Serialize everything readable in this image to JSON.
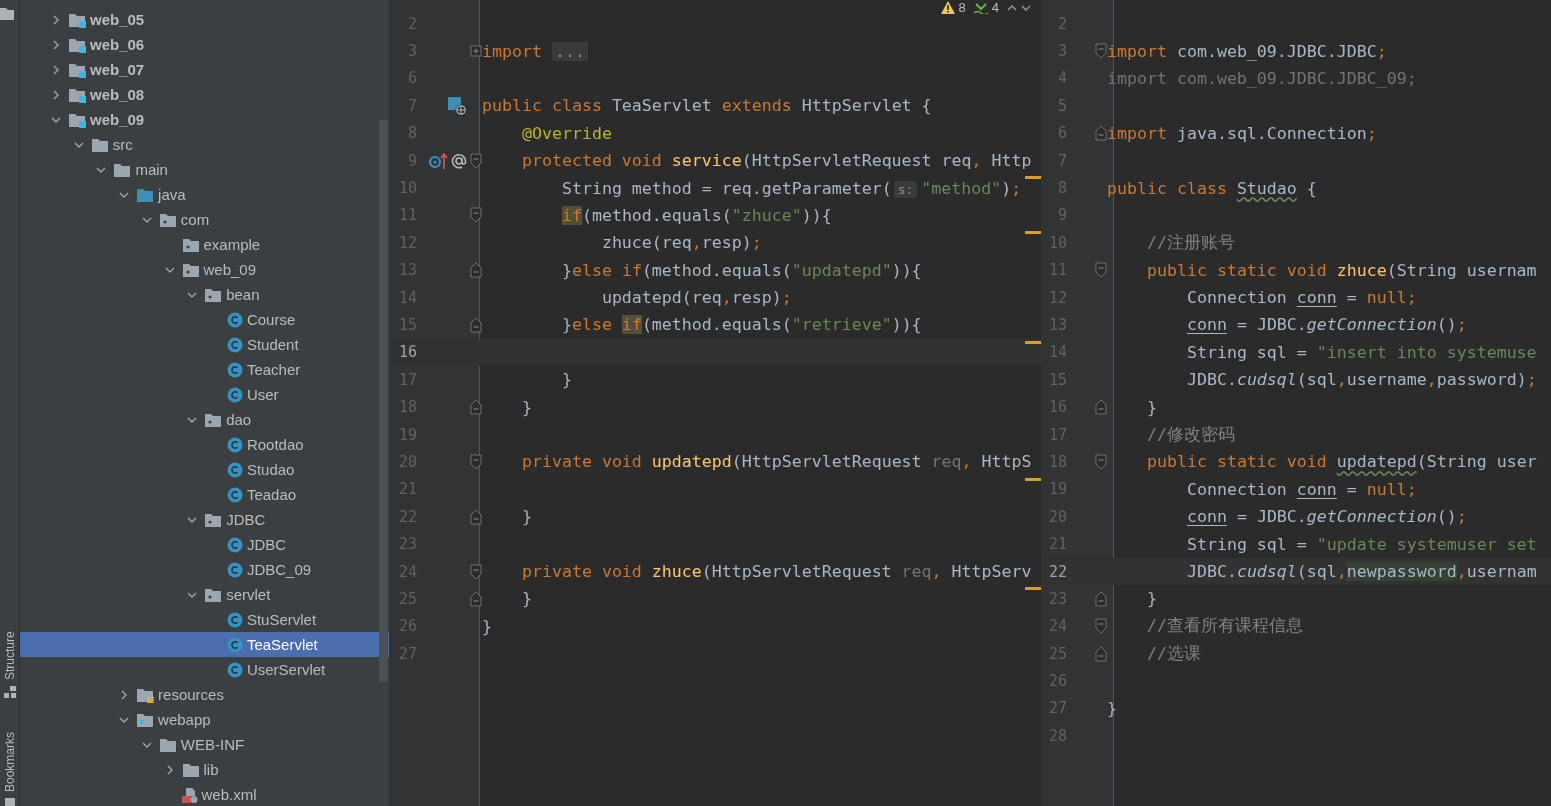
{
  "tool_strip": {
    "labels": [
      "Structure",
      "Bookmarks"
    ]
  },
  "tree": {
    "items": [
      {
        "label": "web_05",
        "kind": "module",
        "expanded": false,
        "selected": false
      },
      {
        "label": "web_06",
        "kind": "module",
        "expanded": false,
        "selected": false
      },
      {
        "label": "web_07",
        "kind": "module",
        "expanded": false,
        "selected": false
      },
      {
        "label": "web_08",
        "kind": "module",
        "expanded": false,
        "selected": false
      },
      {
        "label": "web_09",
        "kind": "module",
        "expanded": true,
        "selected": false,
        "children": [
          {
            "label": "src",
            "kind": "folder",
            "expanded": true,
            "selected": false,
            "children": [
              {
                "label": "main",
                "kind": "folder",
                "expanded": true,
                "selected": false,
                "children": [
                  {
                    "label": "java",
                    "kind": "source",
                    "expanded": true,
                    "selected": false,
                    "children": [
                      {
                        "label": "com",
                        "kind": "package",
                        "expanded": true,
                        "selected": false,
                        "children": [
                          {
                            "label": "example",
                            "kind": "package",
                            "selected": false
                          },
                          {
                            "label": "web_09",
                            "kind": "package",
                            "expanded": true,
                            "selected": false,
                            "children": [
                              {
                                "label": "bean",
                                "kind": "package",
                                "expanded": true,
                                "selected": false,
                                "children": [
                                  {
                                    "label": "Course",
                                    "kind": "class",
                                    "selected": false
                                  },
                                  {
                                    "label": "Student",
                                    "kind": "class",
                                    "selected": false
                                  },
                                  {
                                    "label": "Teacher",
                                    "kind": "class",
                                    "selected": false
                                  },
                                  {
                                    "label": "User",
                                    "kind": "class",
                                    "selected": false
                                  }
                                ]
                              },
                              {
                                "label": "dao",
                                "kind": "package",
                                "expanded": true,
                                "selected": false,
                                "children": [
                                  {
                                    "label": "Rootdao",
                                    "kind": "class",
                                    "selected": false
                                  },
                                  {
                                    "label": "Studao",
                                    "kind": "class",
                                    "selected": false
                                  },
                                  {
                                    "label": "Teadao",
                                    "kind": "class",
                                    "selected": false
                                  }
                                ]
                              },
                              {
                                "label": "JDBC",
                                "kind": "package",
                                "expanded": true,
                                "selected": false,
                                "children": [
                                  {
                                    "label": "JDBC",
                                    "kind": "class",
                                    "selected": false
                                  },
                                  {
                                    "label": "JDBC_09",
                                    "kind": "class",
                                    "selected": false
                                  }
                                ]
                              },
                              {
                                "label": "servlet",
                                "kind": "package",
                                "expanded": true,
                                "selected": false,
                                "children": [
                                  {
                                    "label": "StuServlet",
                                    "kind": "class",
                                    "selected": false
                                  },
                                  {
                                    "label": "TeaServlet",
                                    "kind": "class",
                                    "selected": true
                                  },
                                  {
                                    "label": "UserServlet",
                                    "kind": "class",
                                    "selected": false
                                  }
                                ]
                              }
                            ]
                          }
                        ]
                      }
                    ]
                  },
                  {
                    "label": "resources",
                    "kind": "resources",
                    "expanded": false,
                    "selected": false
                  },
                  {
                    "label": "webapp",
                    "kind": "webapp",
                    "expanded": true,
                    "selected": false,
                    "children": [
                      {
                        "label": "WEB-INF",
                        "kind": "folder",
                        "expanded": true,
                        "selected": false,
                        "children": [
                          {
                            "label": "lib",
                            "kind": "folder",
                            "expanded": false,
                            "selected": false
                          },
                          {
                            "label": "web.xml",
                            "kind": "xml",
                            "selected": false
                          }
                        ]
                      }
                    ]
                  }
                ]
              }
            ]
          }
        ]
      }
    ]
  },
  "editors": [
    {
      "inspections": {
        "warnings": "8",
        "weak_warnings": "4"
      },
      "lines": [
        {
          "n": "2",
          "current": false,
          "warn": false
        },
        {
          "n": "3",
          "current": false,
          "warn": false,
          "fold": {
            "kind": "plus"
          },
          "tokens": [
            {
              "kind": "kw",
              "text": "import "
            },
            {
              "kind": "folded",
              "text": "..."
            }
          ]
        },
        {
          "n": "6",
          "current": false,
          "warn": false
        },
        {
          "n": "7",
          "current": false,
          "warn": false,
          "gutter": {
            "kind": "servlet"
          },
          "tokens": [
            {
              "kind": "kw",
              "text": "public class "
            },
            {
              "kind": "p",
              "text": "TeaServlet "
            },
            {
              "kind": "kw",
              "text": "extends "
            },
            {
              "kind": "p",
              "text": "HttpServlet {"
            }
          ]
        },
        {
          "n": "8",
          "current": false,
          "warn": false,
          "tokens": [
            {
              "kind": "ann",
              "text": "    @Override"
            }
          ]
        },
        {
          "n": "9",
          "current": false,
          "warn": false,
          "gutter": {
            "kind": "override"
          },
          "fold": {
            "kind": "open"
          },
          "tokens": [
            {
              "kind": "kw",
              "text": "    protected void "
            },
            {
              "kind": "fn",
              "text": "service"
            },
            {
              "kind": "p",
              "text": "(HttpServletRequest req"
            },
            {
              "kind": "kw",
              "text": ", "
            },
            {
              "kind": "p",
              "text": "Http"
            }
          ]
        },
        {
          "n": "10",
          "current": false,
          "warn": true,
          "tokens": [
            {
              "kind": "p",
              "text": "        String method = req.getParameter("
            },
            {
              "kind": "hint",
              "text": "s:"
            },
            {
              "kind": "str",
              "text": "\"method\""
            },
            {
              "kind": "p",
              "text": ")"
            },
            {
              "kind": "kw",
              "text": ";"
            }
          ]
        },
        {
          "n": "11",
          "current": false,
          "warn": false,
          "fold": {
            "kind": "open"
          },
          "tokens": [
            {
              "kind": "hlkw",
              "text": "        if"
            },
            {
              "kind": "p",
              "text": "(method.equals("
            },
            {
              "kind": "str",
              "text": "\"zhuce\""
            },
            {
              "kind": "p",
              "text": ")){"
            }
          ]
        },
        {
          "n": "12",
          "current": false,
          "warn": true,
          "tokens": [
            {
              "kind": "p",
              "text": "            zhuce(req"
            },
            {
              "kind": "kw",
              "text": ","
            },
            {
              "kind": "p",
              "text": "resp)"
            },
            {
              "kind": "kw",
              "text": ";"
            }
          ]
        },
        {
          "n": "13",
          "current": false,
          "warn": false,
          "fold": {
            "kind": "close"
          },
          "tokens": [
            {
              "kind": "p",
              "text": "        }"
            },
            {
              "kind": "kw",
              "text": "else if"
            },
            {
              "kind": "p",
              "text": "(method.equals("
            },
            {
              "kind": "str",
              "text": "\"updatepd\""
            },
            {
              "kind": "p",
              "text": ")){"
            }
          ]
        },
        {
          "n": "14",
          "current": false,
          "warn": false,
          "tokens": [
            {
              "kind": "p",
              "text": "            updatepd(req"
            },
            {
              "kind": "kw",
              "text": ","
            },
            {
              "kind": "p",
              "text": "resp)"
            },
            {
              "kind": "kw",
              "text": ";"
            }
          ]
        },
        {
          "n": "15",
          "current": false,
          "warn": false,
          "fold": {
            "kind": "close"
          },
          "tokens": [
            {
              "kind": "p",
              "text": "        }"
            },
            {
              "kind": "kw",
              "text": "else "
            },
            {
              "kind": "hlkw",
              "text": "if"
            },
            {
              "kind": "p",
              "text": "(method.equals("
            },
            {
              "kind": "str",
              "text": "\"retrieve\""
            },
            {
              "kind": "p",
              "text": ")){"
            }
          ]
        },
        {
          "n": "16",
          "current": true,
          "warn": true
        },
        {
          "n": "17",
          "current": false,
          "warn": false,
          "tokens": [
            {
              "kind": "p",
              "text": "        }"
            }
          ]
        },
        {
          "n": "18",
          "current": false,
          "warn": false,
          "fold": {
            "kind": "close"
          },
          "tokens": [
            {
              "kind": "p",
              "text": "    }"
            }
          ]
        },
        {
          "n": "19",
          "current": false,
          "warn": false
        },
        {
          "n": "20",
          "current": false,
          "warn": false,
          "fold": {
            "kind": "open"
          },
          "tokens": [
            {
              "kind": "kw",
              "text": "    private void "
            },
            {
              "kind": "fn",
              "text": "updatepd"
            },
            {
              "kind": "p",
              "text": "(HttpServletRequest "
            },
            {
              "kind": "dim",
              "text": "req"
            },
            {
              "kind": "kw",
              "text": ", "
            },
            {
              "kind": "p",
              "text": "HttpS"
            }
          ]
        },
        {
          "n": "21",
          "current": false,
          "warn": true
        },
        {
          "n": "22",
          "current": false,
          "warn": false,
          "fold": {
            "kind": "close"
          },
          "tokens": [
            {
              "kind": "p",
              "text": "    }"
            }
          ]
        },
        {
          "n": "23",
          "current": false,
          "warn": false
        },
        {
          "n": "24",
          "current": false,
          "warn": false,
          "fold": {
            "kind": "open"
          },
          "tokens": [
            {
              "kind": "kw",
              "text": "    private void "
            },
            {
              "kind": "fn",
              "text": "zhuce"
            },
            {
              "kind": "p",
              "text": "(HttpServletRequest "
            },
            {
              "kind": "dim",
              "text": "req"
            },
            {
              "kind": "kw",
              "text": ", "
            },
            {
              "kind": "p",
              "text": "HttpServ"
            }
          ]
        },
        {
          "n": "25",
          "current": false,
          "warn": true,
          "fold": {
            "kind": "close"
          },
          "tokens": [
            {
              "kind": "p",
              "text": "    }"
            }
          ]
        },
        {
          "n": "26",
          "current": false,
          "warn": false,
          "tokens": [
            {
              "kind": "p",
              "text": "}"
            }
          ]
        },
        {
          "n": "27",
          "current": false,
          "warn": false
        }
      ]
    },
    {
      "lines": [
        {
          "n": "2",
          "current": false
        },
        {
          "n": "3",
          "current": false,
          "fold": {
            "kind": "open"
          },
          "tokens": [
            {
              "kind": "kw",
              "text": "import "
            },
            {
              "kind": "p",
              "text": "com.web_09.JDBC.JDBC"
            },
            {
              "kind": "kw",
              "text": ";"
            }
          ]
        },
        {
          "n": "4",
          "current": false,
          "tokens": [
            {
              "kind": "dim",
              "text": "import com.web_09.JDBC.JDBC_09;"
            }
          ]
        },
        {
          "n": "5",
          "current": false
        },
        {
          "n": "6",
          "current": false,
          "fold": {
            "kind": "close"
          },
          "tokens": [
            {
              "kind": "kw",
              "text": "import "
            },
            {
              "kind": "p",
              "text": "java.sql.Connection"
            },
            {
              "kind": "kw",
              "text": ";"
            }
          ]
        },
        {
          "n": "7",
          "current": false
        },
        {
          "n": "8",
          "current": false,
          "tokens": [
            {
              "kind": "kw",
              "text": "public class "
            },
            {
              "kind": "typo",
              "text": "Studao"
            },
            {
              "kind": "p",
              "text": " {"
            }
          ]
        },
        {
          "n": "9",
          "current": false
        },
        {
          "n": "10",
          "current": false,
          "tokens": [
            {
              "kind": "cmt",
              "text": "    //注册账号"
            }
          ]
        },
        {
          "n": "11",
          "current": false,
          "fold": {
            "kind": "open"
          },
          "tokens": [
            {
              "kind": "kw",
              "text": "    public static void "
            },
            {
              "kind": "fn",
              "text": "zhuce"
            },
            {
              "kind": "p",
              "text": "(String usernam"
            }
          ]
        },
        {
          "n": "12",
          "current": false,
          "tokens": [
            {
              "kind": "p",
              "text": "        Connection "
            },
            {
              "kind": "var",
              "text": "conn"
            },
            {
              "kind": "p",
              "text": " = "
            },
            {
              "kind": "kw",
              "text": "null;"
            }
          ]
        },
        {
          "n": "13",
          "current": false,
          "tokens": [
            {
              "kind": "var",
              "text": "        conn"
            },
            {
              "kind": "p",
              "text": " = JDBC."
            },
            {
              "kind": "ital",
              "text": "getConnection"
            },
            {
              "kind": "p",
              "text": "()"
            },
            {
              "kind": "kw",
              "text": ";"
            }
          ]
        },
        {
          "n": "14",
          "current": false,
          "tokens": [
            {
              "kind": "p",
              "text": "        String sql = "
            },
            {
              "kind": "str",
              "text": "\"insert into systemuse"
            }
          ]
        },
        {
          "n": "15",
          "current": false,
          "tokens": [
            {
              "kind": "p",
              "text": "        JDBC."
            },
            {
              "kind": "ital",
              "text": "cudsql"
            },
            {
              "kind": "p",
              "text": "(sql"
            },
            {
              "kind": "kw",
              "text": ","
            },
            {
              "kind": "p",
              "text": "username"
            },
            {
              "kind": "kw",
              "text": ","
            },
            {
              "kind": "p",
              "text": "password)"
            },
            {
              "kind": "kw",
              "text": ";"
            }
          ]
        },
        {
          "n": "16",
          "current": false,
          "fold": {
            "kind": "close"
          },
          "tokens": [
            {
              "kind": "p",
              "text": "    }"
            }
          ]
        },
        {
          "n": "17",
          "current": false,
          "tokens": [
            {
              "kind": "cmt",
              "text": "    //修改密码"
            }
          ]
        },
        {
          "n": "18",
          "current": false,
          "fold": {
            "kind": "open"
          },
          "tokens": [
            {
              "kind": "kw",
              "text": "    public static void "
            },
            {
              "kind": "typo",
              "text": "updatepd"
            },
            {
              "kind": "p",
              "text": "(String user"
            }
          ]
        },
        {
          "n": "19",
          "current": false,
          "tokens": [
            {
              "kind": "p",
              "text": "        Connection "
            },
            {
              "kind": "var",
              "text": "conn"
            },
            {
              "kind": "p",
              "text": " = "
            },
            {
              "kind": "kw",
              "text": "null;"
            }
          ]
        },
        {
          "n": "20",
          "current": false,
          "tokens": [
            {
              "kind": "var",
              "text": "        conn"
            },
            {
              "kind": "p",
              "text": " = JDBC."
            },
            {
              "kind": "ital",
              "text": "getConnection"
            },
            {
              "kind": "p",
              "text": "()"
            },
            {
              "kind": "kw",
              "text": ";"
            }
          ]
        },
        {
          "n": "21",
          "current": false,
          "tokens": [
            {
              "kind": "p",
              "text": "        String sql = "
            },
            {
              "kind": "str",
              "text": "\"update systemuser set"
            }
          ]
        },
        {
          "n": "22",
          "current": true,
          "tokens": [
            {
              "kind": "p",
              "text": "        JDBC."
            },
            {
              "kind": "ital",
              "text": "cudsql"
            },
            {
              "kind": "p",
              "text": "(sql"
            },
            {
              "kind": "kw",
              "text": ","
            },
            {
              "kind": "sel",
              "text": "newpassword"
            },
            {
              "kind": "kw",
              "text": ","
            },
            {
              "kind": "p",
              "text": "usernam"
            }
          ]
        },
        {
          "n": "23",
          "current": false,
          "fold": {
            "kind": "close"
          },
          "tokens": [
            {
              "kind": "p",
              "text": "    }"
            }
          ]
        },
        {
          "n": "24",
          "current": false,
          "fold": {
            "kind": "open"
          },
          "tokens": [
            {
              "kind": "cmt",
              "text": "    //查看所有课程信息"
            }
          ]
        },
        {
          "n": "25",
          "current": false,
          "fold": {
            "kind": "close"
          },
          "tokens": [
            {
              "kind": "cmt",
              "text": "    //选课"
            }
          ]
        },
        {
          "n": "26",
          "current": false
        },
        {
          "n": "27",
          "current": false,
          "tokens": [
            {
              "kind": "p",
              "text": "}"
            }
          ]
        },
        {
          "n": "28",
          "current": false
        }
      ]
    }
  ]
}
